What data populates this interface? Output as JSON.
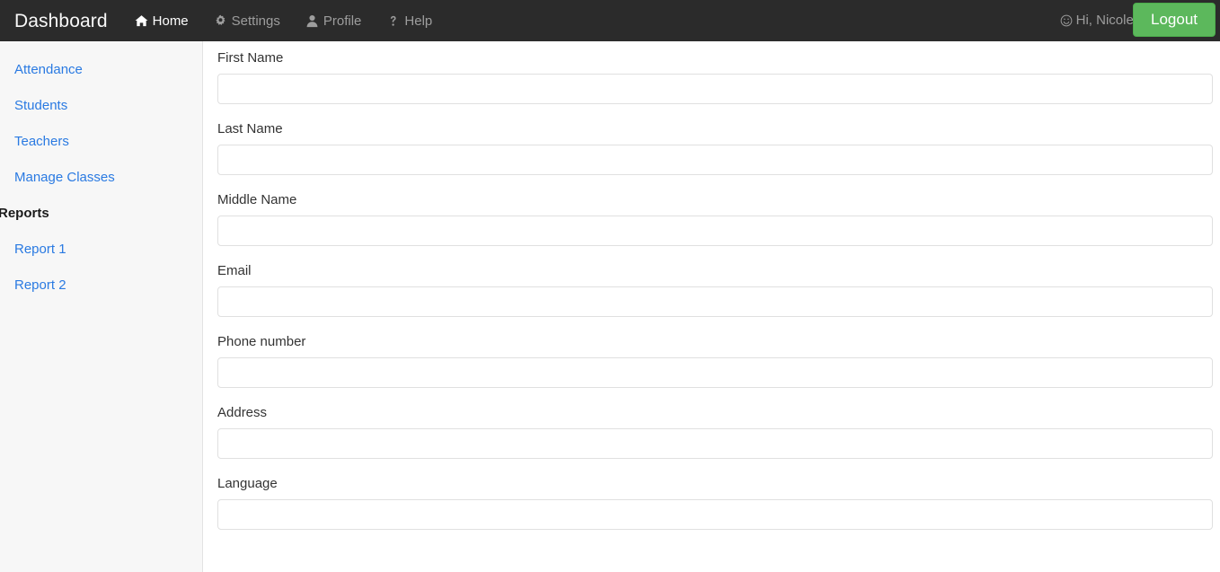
{
  "navbar": {
    "brand": "Dashboard",
    "items": [
      {
        "label": "Home",
        "icon": "home-icon",
        "active": true
      },
      {
        "label": "Settings",
        "icon": "gear-icon",
        "active": false
      },
      {
        "label": "Profile",
        "icon": "user-icon",
        "active": false
      },
      {
        "label": "Help",
        "icon": "question-mark-icon",
        "active": false
      }
    ],
    "greeting": "Hi, Nicole!",
    "greeting_icon": "smiley-face-icon",
    "logout_label": "Logout",
    "background_color": "#2b2b2b",
    "logout_color": "#5cb85c"
  },
  "sidebar": {
    "items": [
      {
        "label": "Attendance",
        "type": "link"
      },
      {
        "label": "Students",
        "type": "link"
      },
      {
        "label": "Teachers",
        "type": "link"
      },
      {
        "label": "Manage Classes",
        "type": "link"
      }
    ],
    "reports_heading": "Reports",
    "reports": [
      {
        "label": "Report 1",
        "type": "link"
      },
      {
        "label": "Report 2",
        "type": "link"
      }
    ],
    "link_color": "#2a7ae2"
  },
  "form": {
    "fields": [
      {
        "label": "First Name",
        "value": "",
        "placeholder": ""
      },
      {
        "label": "Last Name",
        "value": "",
        "placeholder": ""
      },
      {
        "label": "Middle Name",
        "value": "",
        "placeholder": ""
      },
      {
        "label": "Email",
        "value": "",
        "placeholder": ""
      },
      {
        "label": "Phone number",
        "value": "",
        "placeholder": ""
      },
      {
        "label": "Address",
        "value": "",
        "placeholder": ""
      },
      {
        "label": "Language",
        "value": "",
        "placeholder": ""
      }
    ]
  }
}
